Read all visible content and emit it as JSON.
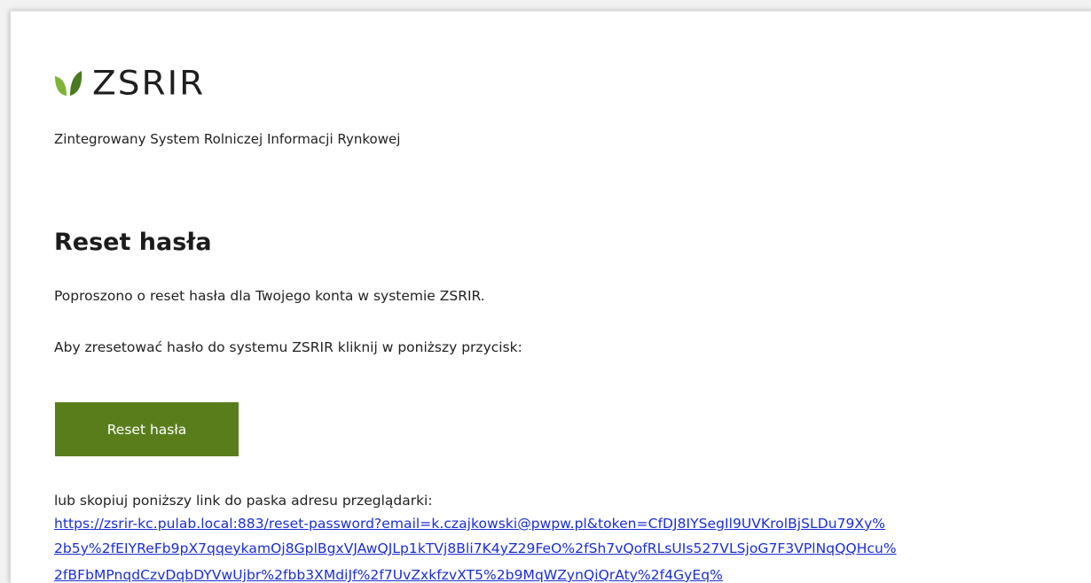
{
  "brand": {
    "logo_text": "ZSRIR",
    "tagline": "Zintegrowany System Rolniczej Informacji Rynkowej",
    "logo_icon": "leaf-icon",
    "colors": {
      "leaf_green": "#6ea22b",
      "leaf_dark": "#4a7a1e",
      "button_green": "#5a7d1c",
      "link_blue": "#1a2ed6"
    }
  },
  "email": {
    "title": "Reset hasła",
    "paragraph1": "Poproszono o reset hasła dla Twojego konta w systemie ZSRIR.",
    "paragraph2": "Aby zresetować hasło do systemu ZSRIR kliknij w poniższy przycisk:",
    "button_label": "Reset hasła",
    "copy_label": "lub skopiuj poniższy link do paska adresu przeglądarki:",
    "link_lines": [
      "https://zsrir-kc.pulab.local:883/reset-password?email=k.czajkowski@pwpw.pl&token=CfDJ8IYSegIl9UVKrolBjSLDu79Xy%",
      "2b5y%2fEIYReFb9pX7qqeykamOj8GplBgxVJAwQJLp1kTVj8Bli7K4yZ29FeO%2fSh7vQofRLsUIs527VLSjoG7F3VPlNqQQHcu%",
      "2fBFbMPnqdCzvDqbDYVwUjbr%2fbb3XMdiJf%2f7UvZxkfzvXT5%2b9MqWZynQiQrAty%2f4GyEq%"
    ]
  }
}
